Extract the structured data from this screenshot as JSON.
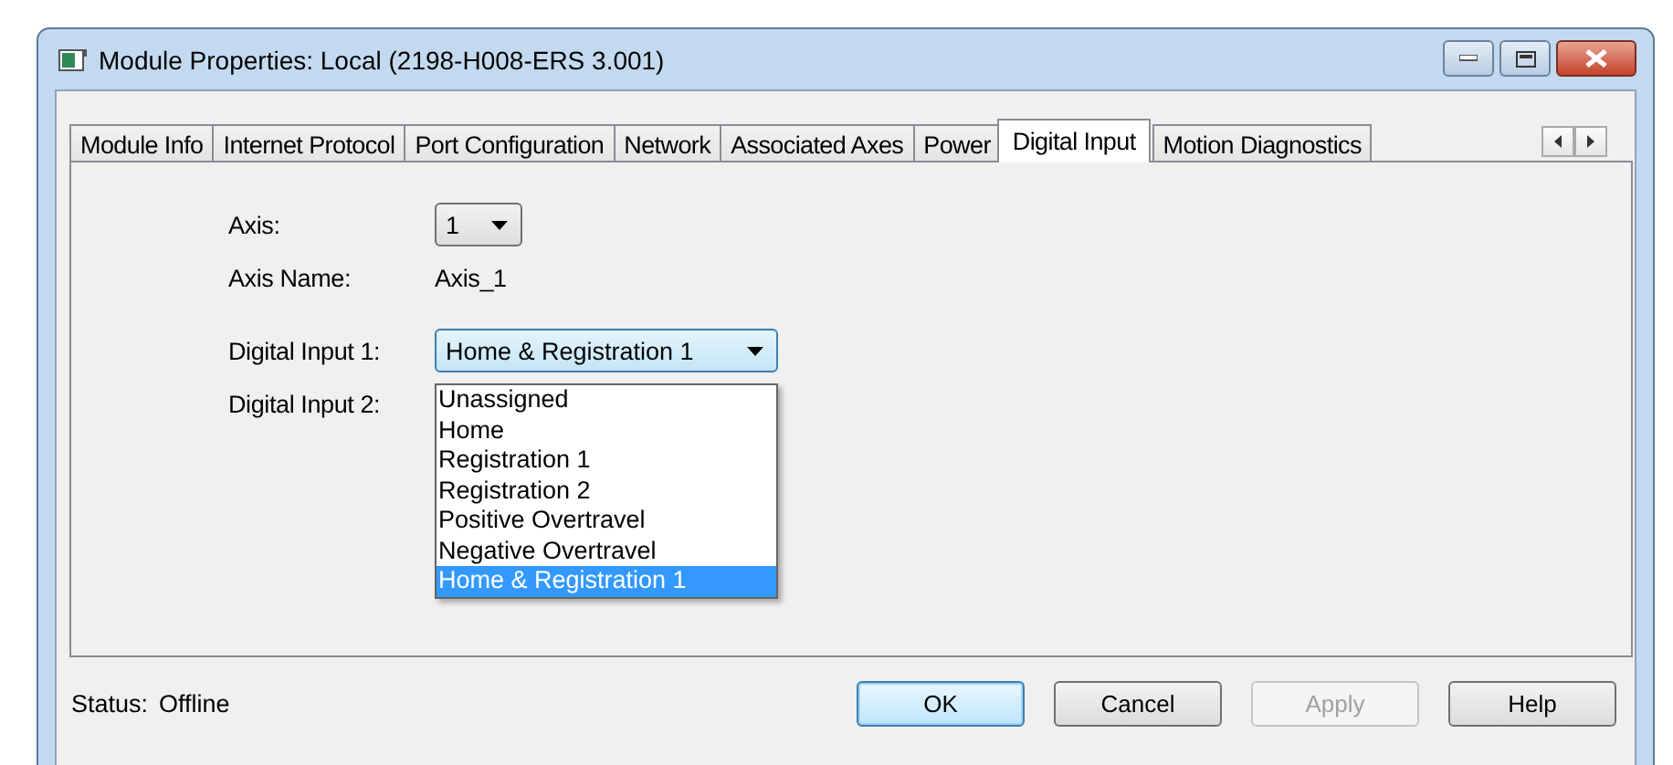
{
  "window": {
    "title": "Module Properties: Local (2198-H008-ERS 3.001)"
  },
  "tabs": [
    {
      "label": "Module Info",
      "selected": false
    },
    {
      "label": "Internet Protocol",
      "selected": false
    },
    {
      "label": "Port Configuration",
      "selected": false
    },
    {
      "label": "Network",
      "selected": false
    },
    {
      "label": "Associated Axes",
      "selected": false
    },
    {
      "label": "Power",
      "selected": false
    },
    {
      "label": "Digital Input",
      "selected": true
    },
    {
      "label": "Motion Diagnostics",
      "selected": false
    }
  ],
  "fields": [
    {
      "kind": "select",
      "label": "Axis:",
      "value": "1"
    },
    {
      "kind": "text",
      "label": "Axis Name:",
      "value": "Axis_1"
    },
    {
      "kind": "select",
      "label": "Digital Input 1:",
      "value": "Home & Registration 1",
      "wide": true,
      "expanded": true,
      "options": [
        {
          "label": "Unassigned",
          "selected": false
        },
        {
          "label": "Home",
          "selected": false
        },
        {
          "label": "Registration 1",
          "selected": false
        },
        {
          "label": "Registration 2",
          "selected": false
        },
        {
          "label": "Positive Overtravel",
          "selected": false
        },
        {
          "label": "Negative Overtravel",
          "selected": false
        },
        {
          "label": "Home & Registration 1",
          "selected": true
        }
      ]
    },
    {
      "kind": "covered",
      "label": "Digital Input 2:"
    }
  ],
  "status": {
    "label": "Status:",
    "value": "Offline"
  },
  "buttons": [
    {
      "label": "OK",
      "default": true,
      "disabled": false
    },
    {
      "label": "Cancel",
      "default": false,
      "disabled": false
    },
    {
      "label": "Apply",
      "default": false,
      "disabled": true
    },
    {
      "label": "Help",
      "default": false,
      "disabled": false
    }
  ]
}
